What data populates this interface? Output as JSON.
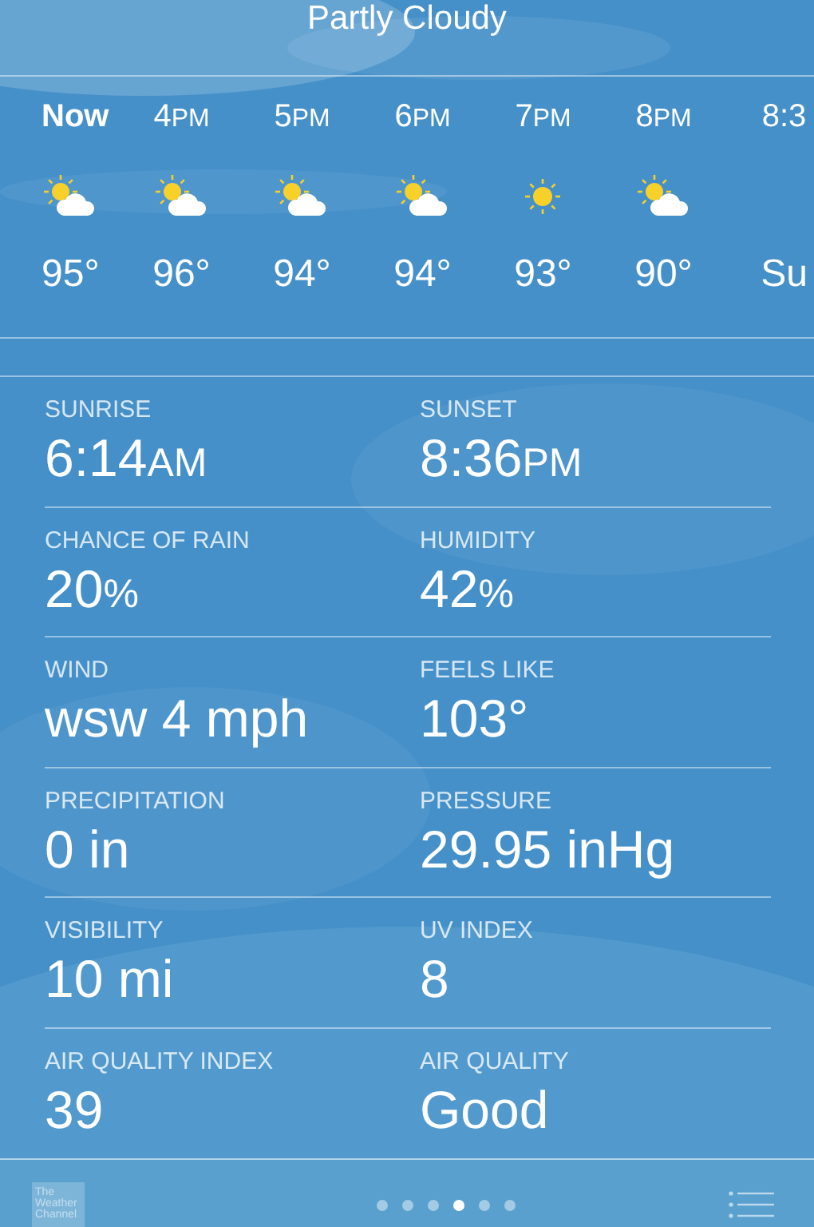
{
  "title": "Partly Cloudy",
  "hourly": [
    {
      "time": "Now",
      "current": true,
      "kind": "partly-cloudy",
      "temp": "95°"
    },
    {
      "time": "4",
      "suffix": "PM",
      "current": false,
      "kind": "partly-cloudy",
      "temp": "96°"
    },
    {
      "time": "5",
      "suffix": "PM",
      "current": false,
      "kind": "partly-cloudy",
      "temp": "94°"
    },
    {
      "time": "6",
      "suffix": "PM",
      "current": false,
      "kind": "partly-cloudy",
      "temp": "94°"
    },
    {
      "time": "7",
      "suffix": "PM",
      "current": false,
      "kind": "sunny",
      "temp": "93°"
    },
    {
      "time": "8",
      "suffix": "PM",
      "current": false,
      "kind": "partly-cloudy",
      "temp": "90°"
    },
    {
      "time": "8:3",
      "current": false,
      "temp": "Su"
    }
  ],
  "details": [
    {
      "label": "SUNRISE",
      "value": "6:14",
      "unit": "AM"
    },
    {
      "label": "SUNSET",
      "value": "8:36",
      "unit": "PM"
    },
    {
      "label": "CHANCE OF RAIN",
      "value": "20",
      "unit": "%"
    },
    {
      "label": "HUMIDITY",
      "value": "42",
      "unit": "%"
    },
    {
      "label": "WIND",
      "value": "wsw 4 mph"
    },
    {
      "label": "FEELS LIKE",
      "value": "103°"
    },
    {
      "label": "PRECIPITATION",
      "value": "0 in"
    },
    {
      "label": "PRESSURE",
      "value": "29.95 inHg"
    },
    {
      "label": "VISIBILITY",
      "value": "10 mi"
    },
    {
      "label": "UV INDEX",
      "value": "8"
    },
    {
      "label": "AIR QUALITY INDEX",
      "value": "39"
    },
    {
      "label": "AIR QUALITY",
      "value": "Good"
    }
  ],
  "footer": {
    "logo": "The Weather Channel",
    "pages": [
      {
        "selected": false
      },
      {
        "selected": false
      },
      {
        "selected": false
      },
      {
        "selected": true
      },
      {
        "selected": false
      },
      {
        "selected": false
      }
    ]
  }
}
